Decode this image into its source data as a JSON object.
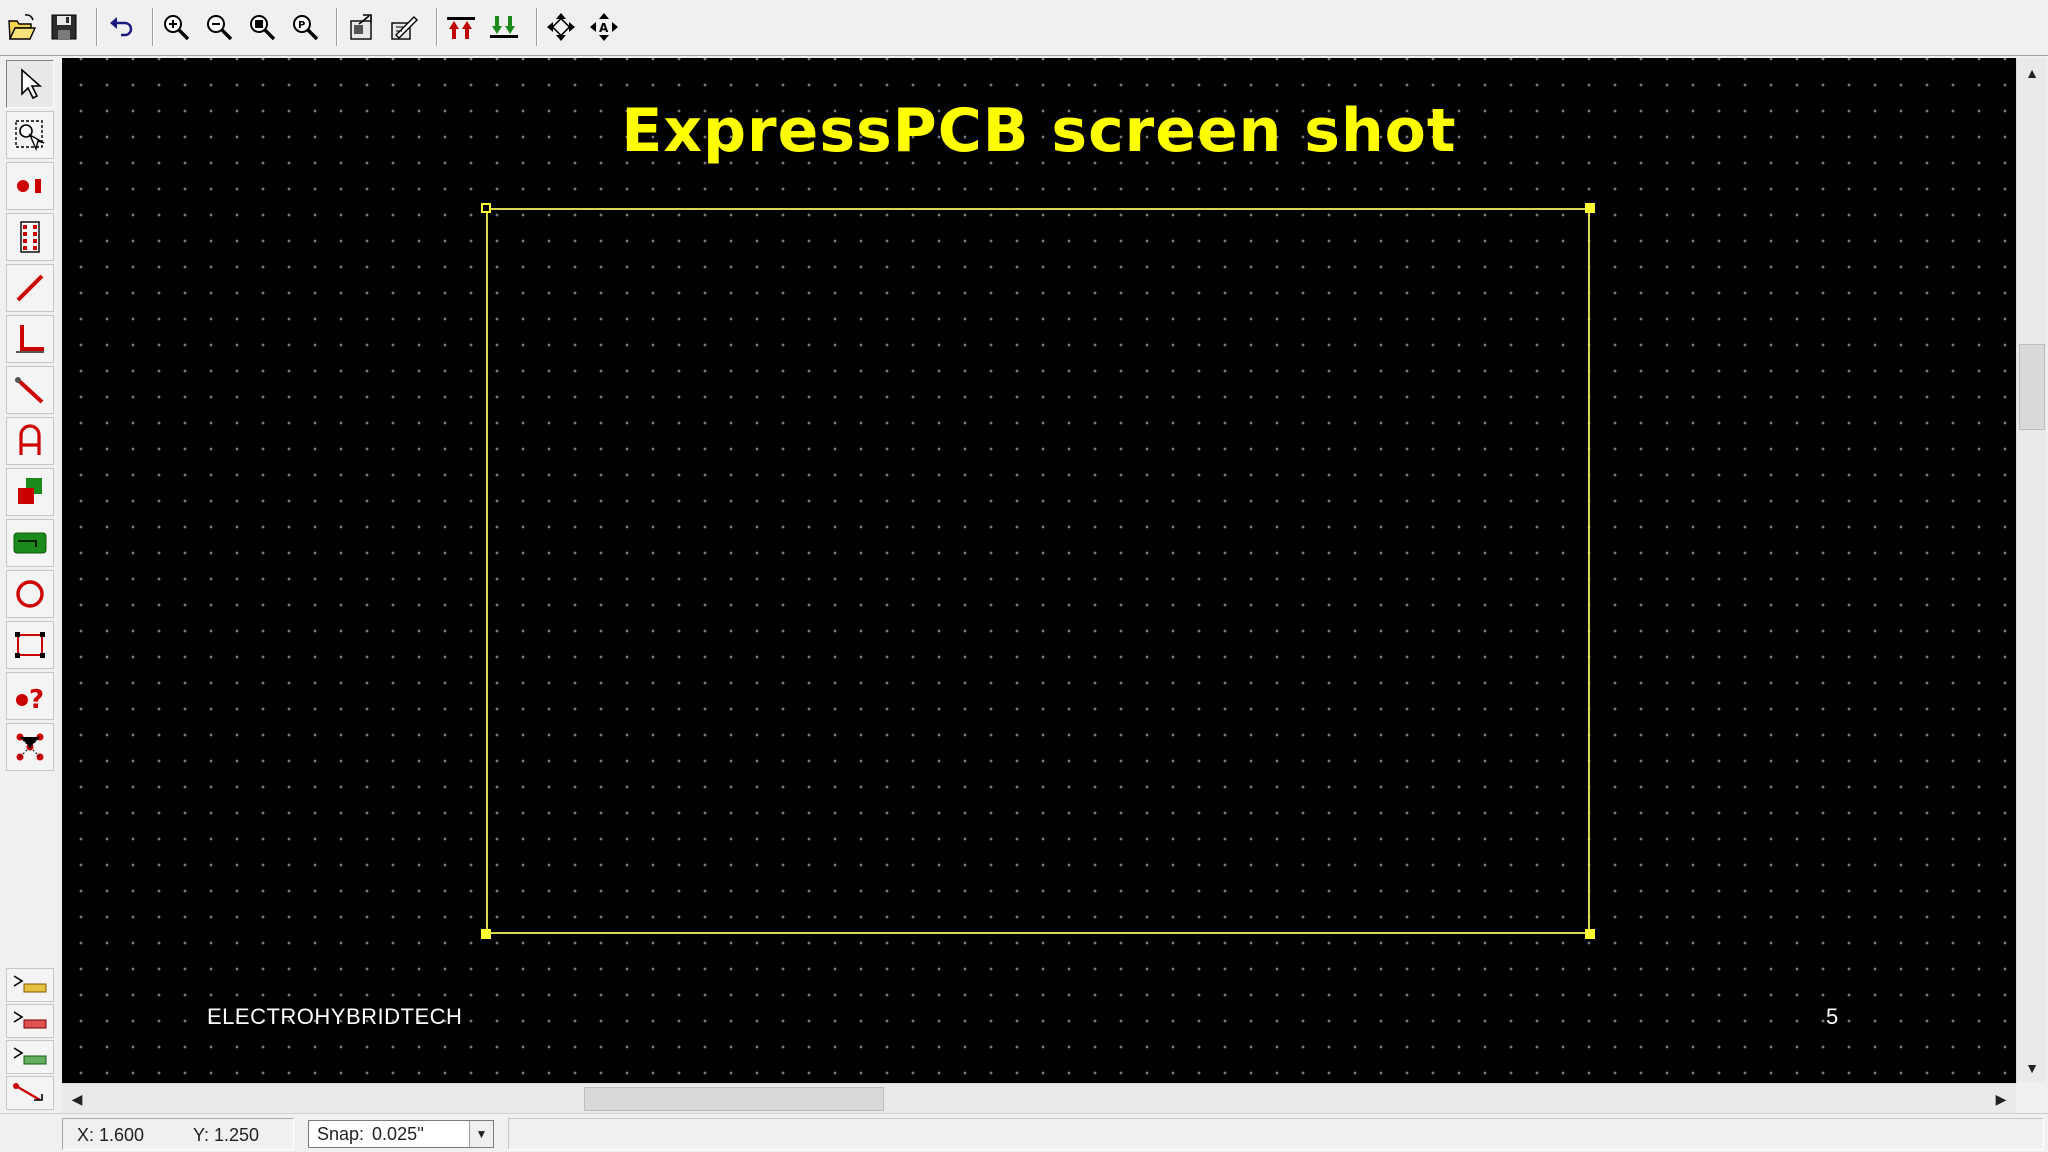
{
  "toolbar": {
    "buttons": [
      {
        "name": "open-file",
        "icon": "folder-open-icon"
      },
      {
        "name": "save",
        "icon": "floppy-disk-icon"
      },
      {
        "name": "undo",
        "icon": "undo-arrow-icon"
      },
      {
        "name": "zoom-in",
        "icon": "zoom-in-icon"
      },
      {
        "name": "zoom-out",
        "icon": "zoom-out-icon"
      },
      {
        "name": "zoom-window",
        "icon": "zoom-window-icon"
      },
      {
        "name": "zoom-fit",
        "icon": "zoom-fit-icon"
      },
      {
        "name": "component-properties",
        "icon": "component-properties-icon"
      },
      {
        "name": "component-manager",
        "icon": "component-manager-icon"
      },
      {
        "name": "bring-to-top-layer",
        "icon": "layer-top-icon"
      },
      {
        "name": "send-to-bottom-layer",
        "icon": "layer-bottom-icon"
      },
      {
        "name": "move",
        "icon": "move-arrows-icon"
      },
      {
        "name": "move-text",
        "icon": "move-text-icon"
      }
    ]
  },
  "palette": {
    "tools": [
      {
        "name": "select",
        "icon": "pointer-arrow-icon"
      },
      {
        "name": "zoom-select",
        "icon": "select-zoom-icon"
      },
      {
        "name": "place-pad",
        "icon": "pad-icon"
      },
      {
        "name": "place-component",
        "icon": "component-icon"
      },
      {
        "name": "place-trace",
        "icon": "trace-icon"
      },
      {
        "name": "place-corner-trace",
        "icon": "corner-trace-icon"
      },
      {
        "name": "place-diagonal-trace",
        "icon": "diagonal-trace-icon"
      },
      {
        "name": "place-text",
        "icon": "text-tool-icon"
      },
      {
        "name": "place-filled-rect",
        "icon": "filled-rect-icon"
      },
      {
        "name": "place-filled-plane",
        "icon": "ground-plane-icon"
      },
      {
        "name": "place-circle",
        "icon": "circle-icon"
      },
      {
        "name": "place-board-outline",
        "icon": "board-outline-icon"
      },
      {
        "name": "pad-query",
        "icon": "pad-query-icon"
      },
      {
        "name": "netlist-connect",
        "icon": "netlist-icon"
      }
    ],
    "layers": [
      {
        "name": "top-layer",
        "icon": "layer-top-selector-icon",
        "color": "#e8c040"
      },
      {
        "name": "bottom-layer",
        "icon": "layer-bottom-selector-icon",
        "color": "#e05050"
      },
      {
        "name": "silkscreen-layer",
        "icon": "layer-silk-selector-icon",
        "color": "#60b060"
      },
      {
        "name": "rats-nest",
        "icon": "rats-nest-icon",
        "color": "#cc0000"
      }
    ]
  },
  "canvas": {
    "title": "ExpressPCB screen shot",
    "footer_left": "ELECTROHYBRIDTECH",
    "footer_right": "5",
    "background": "#000000",
    "title_color": "#ffff00",
    "outline_color": "#d8d850"
  },
  "status": {
    "x": "X: 1.600",
    "y": "Y: 1.250",
    "snap_label": "Snap:",
    "snap_value": "0.025''",
    "snap_options": [
      "0.025''"
    ]
  }
}
